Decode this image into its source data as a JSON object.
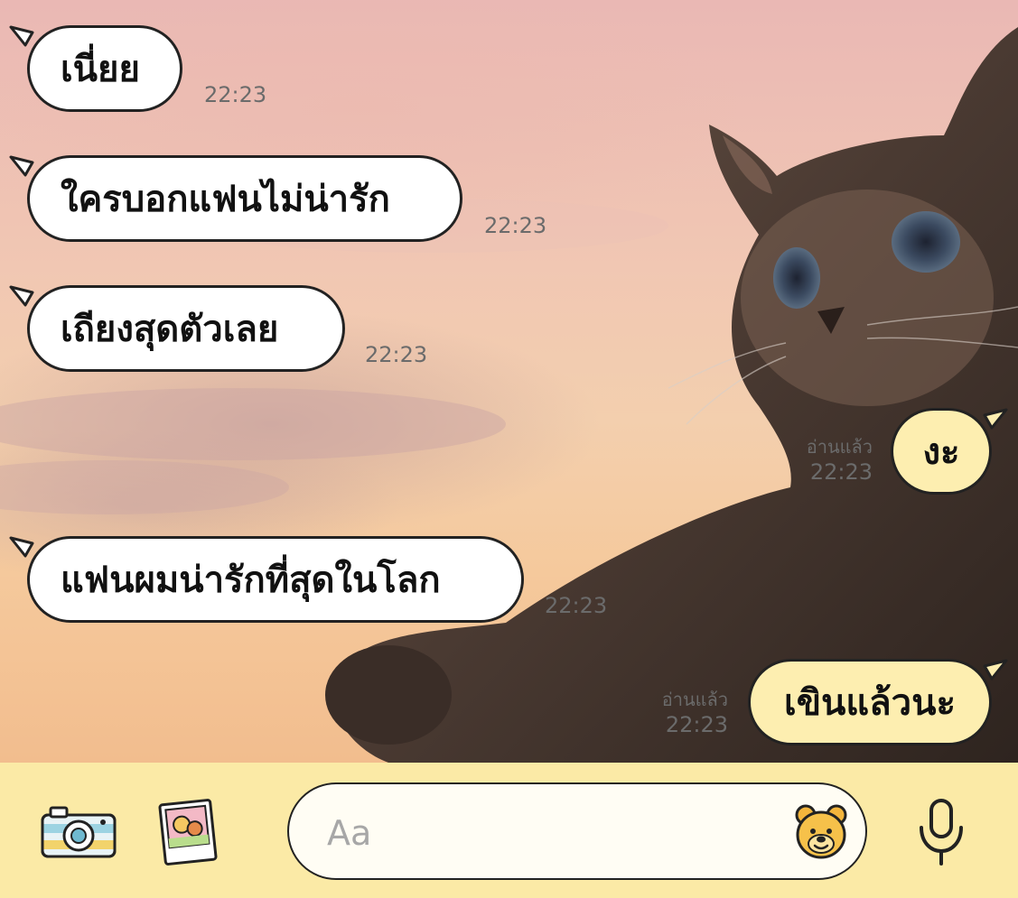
{
  "messages": [
    {
      "id": "m1",
      "direction": "incoming",
      "text": "เนี่ยย",
      "time": "22:23"
    },
    {
      "id": "m2",
      "direction": "incoming",
      "text": "ใครบอกแฟนไม่น่ารัก",
      "time": "22:23"
    },
    {
      "id": "m3",
      "direction": "incoming",
      "text": "เถียงสุดตัวเลย",
      "time": "22:23"
    },
    {
      "id": "m4",
      "direction": "outgoing",
      "text": "งะ",
      "read_label": "อ่านแล้ว",
      "time": "22:23"
    },
    {
      "id": "m5",
      "direction": "incoming",
      "text": "แฟนผมน่ารักที่สุดในโลก",
      "time": "22:23"
    },
    {
      "id": "m6",
      "direction": "outgoing",
      "text": "เขินแล้วนะ",
      "read_label": "อ่านแล้ว",
      "time": "22:23"
    }
  ],
  "input_bar": {
    "placeholder": "Aa",
    "icons": [
      "camera-icon",
      "photo-gallery-icon",
      "sticker-emoji-icon",
      "microphone-icon"
    ]
  },
  "colors": {
    "incoming_bubble": "#ffffff",
    "outgoing_bubble": "#fdeeb0",
    "bubble_border": "#222222",
    "input_bar_bg": "#fbeaa6",
    "timestamp": "#6b6b6b"
  }
}
